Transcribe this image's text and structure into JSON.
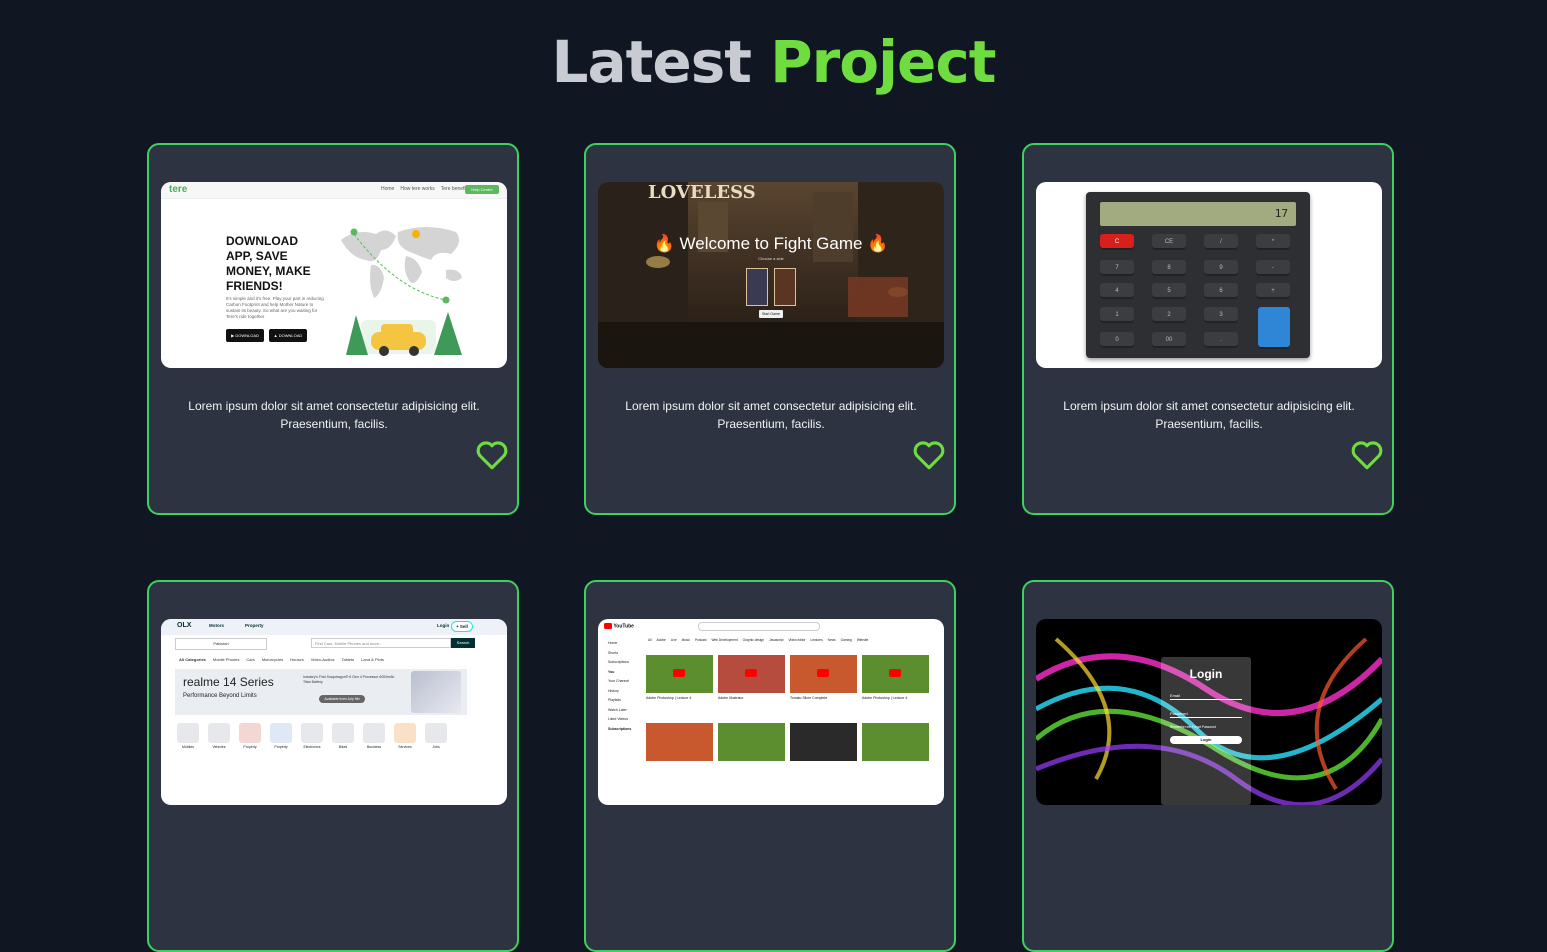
{
  "heading": {
    "part1": "Latest",
    "part2": "Project"
  },
  "cards": [
    {
      "description": "Lorem ipsum dolor sit amet consectetur adipisicing elit. Praesentium, facilis.",
      "preview": {
        "logo": "tere",
        "nav": [
          "Home",
          "How tere works",
          "Tere benefits"
        ],
        "nav_button": "Help Centre",
        "headline": "DOWNLOAD APP, SAVE MONEY, MAKE FRIENDS!",
        "body": "It's simple and it's free. Play your part in reducing Carbon Footprint and help Mother Nature to sustain its beauty. So what are you waiting for Tere's ride together",
        "buttons": [
          "DOWNLOAD",
          "DOWNLOAD"
        ]
      }
    },
    {
      "description": "Lorem ipsum dolor sit amet consectetur adipisicing elit. Praesentium, facilis.",
      "preview": {
        "sign": "LOVELESS",
        "title": "🔥 Welcome to Fight Game 🔥",
        "subtitle": "Choose a side",
        "button": "Start Game"
      }
    },
    {
      "description": "Lorem ipsum dolor sit amet consectetur adipisicing elit. Praesentium, facilis.",
      "preview": {
        "display": "17",
        "keys": [
          "C",
          "CE",
          "/",
          "*",
          "7",
          "8",
          "9",
          "-",
          "4",
          "5",
          "6",
          "+",
          "1",
          "2",
          "3",
          "0",
          "00",
          "."
        ]
      }
    },
    {
      "description": "",
      "preview": {
        "logo": "OLX",
        "tabs": [
          "Motors",
          "Property"
        ],
        "login": "Login",
        "sell": "+ Sell",
        "location": "Pakistan",
        "search_placeholder": "Find Cars, Mobile Phones and more...",
        "search_button": "Search",
        "categories": [
          "All Categories",
          "Mobile Phones",
          "Cars",
          "Motorcycles",
          "Houses",
          "Video-Audios",
          "Tablets",
          "Land & Plots"
        ],
        "banner_title": "realme 14 Series",
        "banner_sub": "Performance Beyond Limits",
        "banner_text": "Industry's First Snapdragon® 6 Gen 4 Processor 6000mAh Titan Battery",
        "banner_badge": "Available from July 9th",
        "icons": [
          "Mobiles",
          "Vehicles",
          "Property",
          "Property",
          "Electronics",
          "Bikes",
          "Business",
          "Services",
          "Jobs"
        ]
      }
    },
    {
      "description": "",
      "preview": {
        "logo": "YouTube",
        "sidebar": [
          "Home",
          "Shorts",
          "Subscriptions",
          "You",
          "Your Channel",
          "History",
          "Playlists",
          "Watch Later",
          "Liked Videos",
          "Subscriptions"
        ],
        "chips": [
          "All",
          "Adobe",
          "Live",
          "Music",
          "Podcast",
          "Web Development",
          "Graphic design",
          "Javascript",
          "Video editor",
          "Lectures",
          "News",
          "Gaming",
          "Website"
        ],
        "videos": [
          "Adobe Photoshop | Lecture 4",
          "Adobe Illustrator",
          "Tomato Slicer Complete",
          "Adobe Photoshop | Lecture 4"
        ]
      }
    },
    {
      "description": "",
      "preview": {
        "title": "Login",
        "field1": "Email",
        "field2": "Password",
        "remember": "Remember me  Forgot Password",
        "button": "Login"
      }
    }
  ]
}
